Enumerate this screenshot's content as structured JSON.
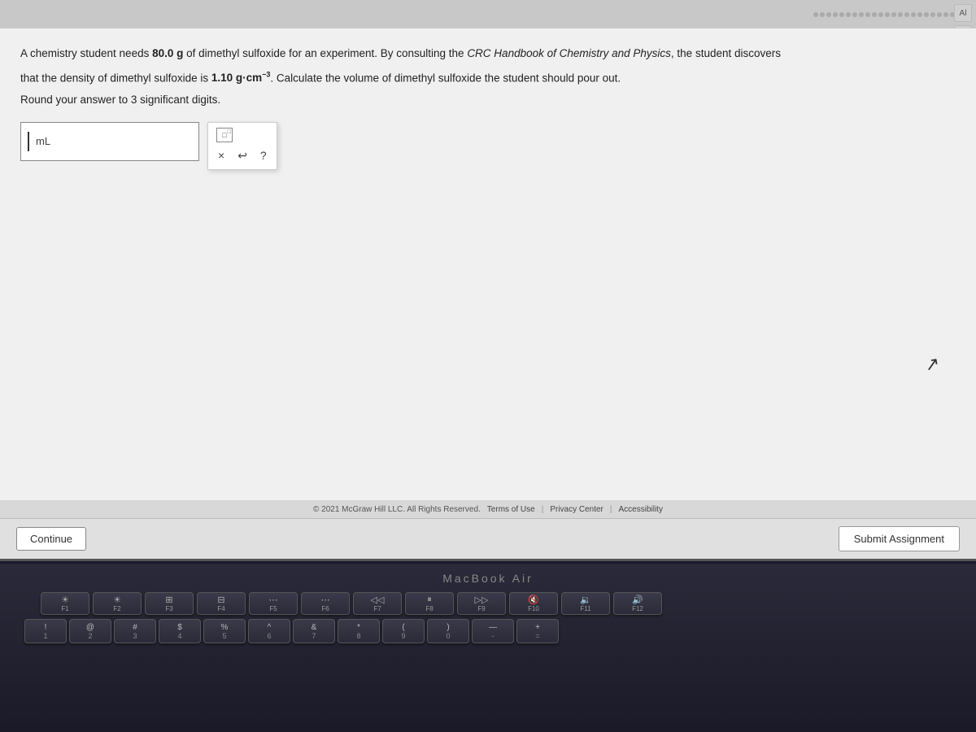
{
  "screen": {
    "question": {
      "line1_part1": "A chemistry student needs ",
      "line1_bold1": "80.0 g",
      "line1_part2": " of dimethyl sulfoxide for an experiment. By consulting the ",
      "line1_italic": "CRC Handbook of Chemistry and Physics",
      "line1_part3": ", the student discovers",
      "line2_part1": "that the density of dimethyl sulfoxide is ",
      "line2_bold2": "1.10 g·cm",
      "line2_sup": "−3",
      "line2_part2": ". Calculate the volume of dimethyl sulfoxide the student should pour out.",
      "sig_figs": "Round your answer to 3 significant digits."
    },
    "input": {
      "placeholder": "",
      "unit": "mL"
    },
    "toolbar": {
      "x10_label": "×10",
      "x_button": "×",
      "undo_button": "↩",
      "help_button": "?"
    },
    "buttons": {
      "continue": "Continue",
      "submit": "Submit Assignment"
    },
    "footer": {
      "copyright": "© 2021 McGraw Hill LLC. All Rights Reserved.",
      "terms": "Terms of Use",
      "privacy": "Privacy Center",
      "accessibility": "Accessibility"
    }
  },
  "keyboard": {
    "macbook_label": "MacBook Air",
    "fn_keys": [
      {
        "label": "F1",
        "icon": "☀"
      },
      {
        "label": "F2",
        "icon": "☀"
      },
      {
        "label": "F3",
        "icon": "⊞"
      },
      {
        "label": "F4",
        "icon": "⊟"
      },
      {
        "label": "F5",
        "icon": "⌨"
      },
      {
        "label": "F6",
        "icon": "⌨"
      },
      {
        "label": "F7",
        "icon": "◁◁"
      },
      {
        "label": "F8",
        "icon": "⏸"
      },
      {
        "label": "F9",
        "icon": "▷▷"
      },
      {
        "label": "F10",
        "icon": "🔇"
      },
      {
        "label": "F11",
        "icon": "🔉"
      },
      {
        "label": "F12",
        "icon": "🔊"
      }
    ],
    "num_row": [
      "!",
      "@",
      "#",
      "$",
      "%",
      "^",
      "&",
      "*",
      "(",
      ")",
      "—",
      "+"
    ]
  },
  "icons": {
    "right_top": "Al",
    "right_bottom": "⊞"
  }
}
